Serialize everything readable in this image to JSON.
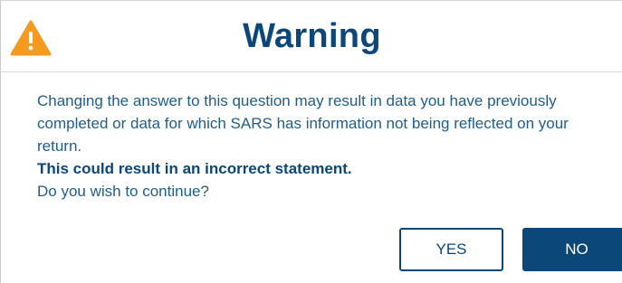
{
  "dialog": {
    "title": "Warning",
    "icon": "warning-triangle-icon",
    "message_lines": [
      "Changing the answer to this question may result in data you have previously",
      "completed or data for which SARS has information not being reflected on your",
      "return."
    ],
    "emphasis": "This could result in an incorrect statement.",
    "question": "Do you wish to continue?",
    "yes_label": "YES",
    "no_label": "NO"
  },
  "colors": {
    "primary": "#0b4779",
    "text": "#1f5d8c",
    "warning": "#f39a1f"
  }
}
